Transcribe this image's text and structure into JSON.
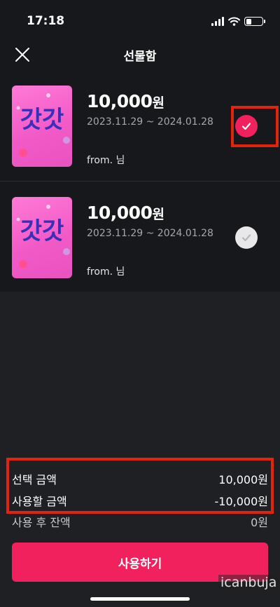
{
  "status": {
    "time": "17:18"
  },
  "header": {
    "title": "선물함",
    "close_icon": "close-icon"
  },
  "gifts": [
    {
      "amount": "10,000",
      "unit": "원",
      "period": "2023.11.29 ~ 2024.01.28",
      "from": "from. 님",
      "selected": true,
      "thumb_text": "갓갓"
    },
    {
      "amount": "10,000",
      "unit": "원",
      "period": "2023.11.29 ~ 2024.01.28",
      "from": "from. 님",
      "selected": false,
      "thumb_text": "갓갓"
    }
  ],
  "summary": {
    "selected_label": "선택 금액",
    "selected_value": "10,000원",
    "use_label": "사용할 금액",
    "use_value": "-10,000원",
    "remain_label": "사용 후 잔액",
    "remain_value": "0원"
  },
  "use_button": "사용하기",
  "watermark": "icanbuja",
  "colors": {
    "accent": "#f0215c",
    "highlight": "#e2240f",
    "background": "#1f2024"
  }
}
